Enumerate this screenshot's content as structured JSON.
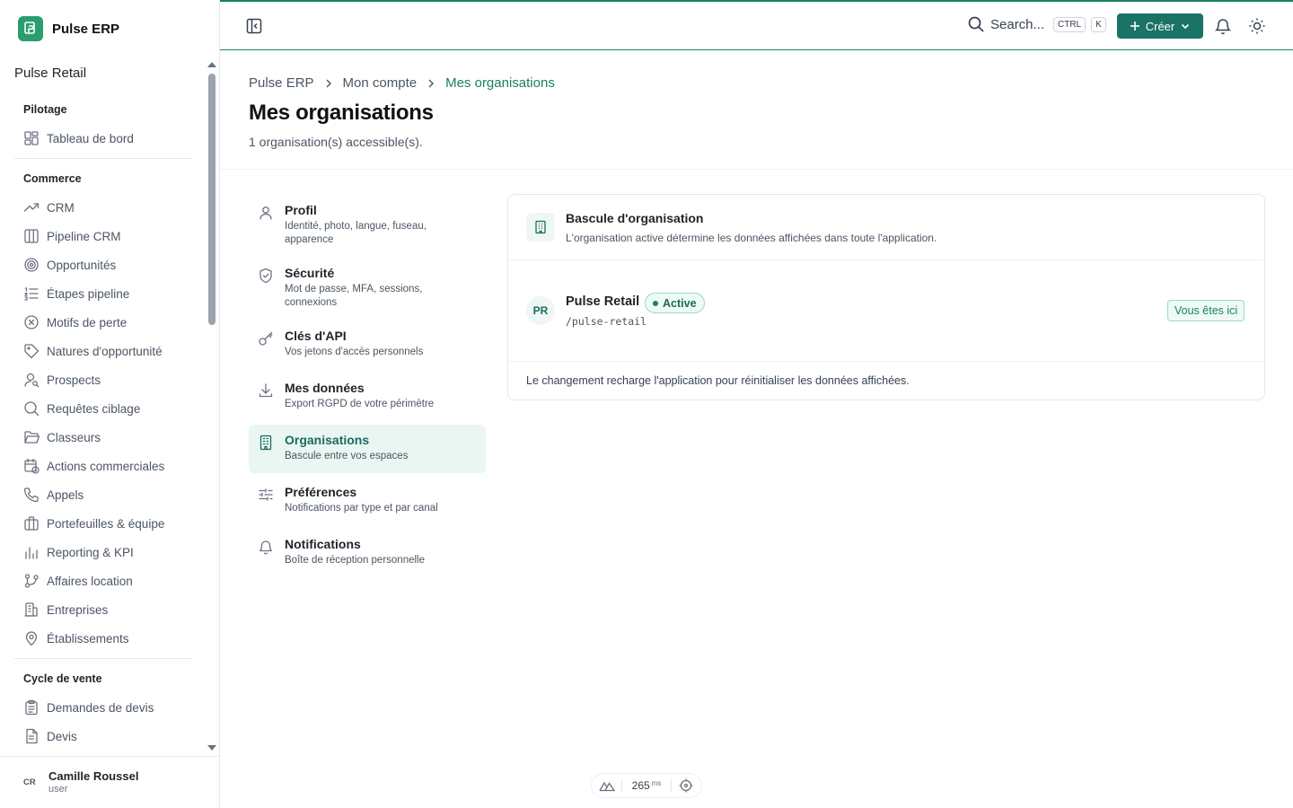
{
  "app": {
    "brand": "Pulse ERP",
    "organization": "Pulse Retail"
  },
  "sidebar": {
    "sections": [
      {
        "title": "Pilotage",
        "items": [
          {
            "label": "Tableau de bord",
            "icon": "layout-dashboard-icon"
          }
        ]
      },
      {
        "title": "Commerce",
        "items": [
          {
            "label": "CRM",
            "icon": "trending-up-icon"
          },
          {
            "label": "Pipeline CRM",
            "icon": "columns-icon"
          },
          {
            "label": "Opportunités",
            "icon": "target-icon"
          },
          {
            "label": "Étapes pipeline",
            "icon": "list-ordered-icon"
          },
          {
            "label": "Motifs de perte",
            "icon": "circle-x-icon"
          },
          {
            "label": "Natures d'opportunité",
            "icon": "tags-icon"
          },
          {
            "label": "Prospects",
            "icon": "user-search-icon"
          },
          {
            "label": "Requêtes ciblage",
            "icon": "search-icon"
          },
          {
            "label": "Classeurs",
            "icon": "folder-open-icon"
          },
          {
            "label": "Actions commerciales",
            "icon": "calendar-clock-icon"
          },
          {
            "label": "Appels",
            "icon": "phone-icon"
          },
          {
            "label": "Portefeuilles & équipe",
            "icon": "briefcase-icon"
          },
          {
            "label": "Reporting & KPI",
            "icon": "bar-chart-icon"
          },
          {
            "label": "Affaires location",
            "icon": "git-branch-icon"
          },
          {
            "label": "Entreprises",
            "icon": "building-icon"
          },
          {
            "label": "Établissements",
            "icon": "map-pin-icon"
          }
        ]
      },
      {
        "title": "Cycle de vente",
        "items": [
          {
            "label": "Demandes de devis",
            "icon": "clipboard-list-icon"
          },
          {
            "label": "Devis",
            "icon": "file-text-icon"
          }
        ]
      }
    ],
    "user": {
      "initials": "CR",
      "name": "Camille Roussel",
      "role": "user"
    }
  },
  "topbar": {
    "search_label": "Search...",
    "shortcut": [
      "CTRL",
      "K"
    ],
    "create_label": "Créer"
  },
  "breadcrumb": [
    "Pulse ERP",
    "Mon compte",
    "Mes organisations"
  ],
  "page": {
    "title": "Mes organisations",
    "subtitle": "1 organisation(s) accessible(s)."
  },
  "settings_nav": [
    {
      "title": "Profil",
      "desc": "Identité, photo, langue, fuseau, apparence",
      "icon": "user-icon",
      "active": false
    },
    {
      "title": "Sécurité",
      "desc": "Mot de passe, MFA, sessions, connexions",
      "icon": "shield-check-icon",
      "active": false
    },
    {
      "title": "Clés d'API",
      "desc": "Vos jetons d'accès personnels",
      "icon": "key-icon",
      "active": false
    },
    {
      "title": "Mes données",
      "desc": "Export RGPD de votre périmètre",
      "icon": "download-icon",
      "active": false
    },
    {
      "title": "Organisations",
      "desc": "Bascule entre vos espaces",
      "icon": "building-icon",
      "active": true
    },
    {
      "title": "Préférences",
      "desc": "Notifications par type et par canal",
      "icon": "sliders-icon",
      "active": false
    },
    {
      "title": "Notifications",
      "desc": "Boîte de réception personnelle",
      "icon": "bell-icon",
      "active": false
    }
  ],
  "card": {
    "title": "Bascule d'organisation",
    "description": "L'organisation active détermine les données affichées dans toute l'application.",
    "org": {
      "initials": "PR",
      "name": "Pulse Retail",
      "status": "Active",
      "slug": "/pulse-retail",
      "here_label": "Vous êtes ici"
    },
    "footer": "Le changement recharge l'application pour réinitialiser les données affichées."
  },
  "devtools": {
    "latency": "265",
    "unit": "ms"
  },
  "colors": {
    "accent": "#1a7f64",
    "button": "#1a7364",
    "active_bg": "#eaf6f2"
  }
}
